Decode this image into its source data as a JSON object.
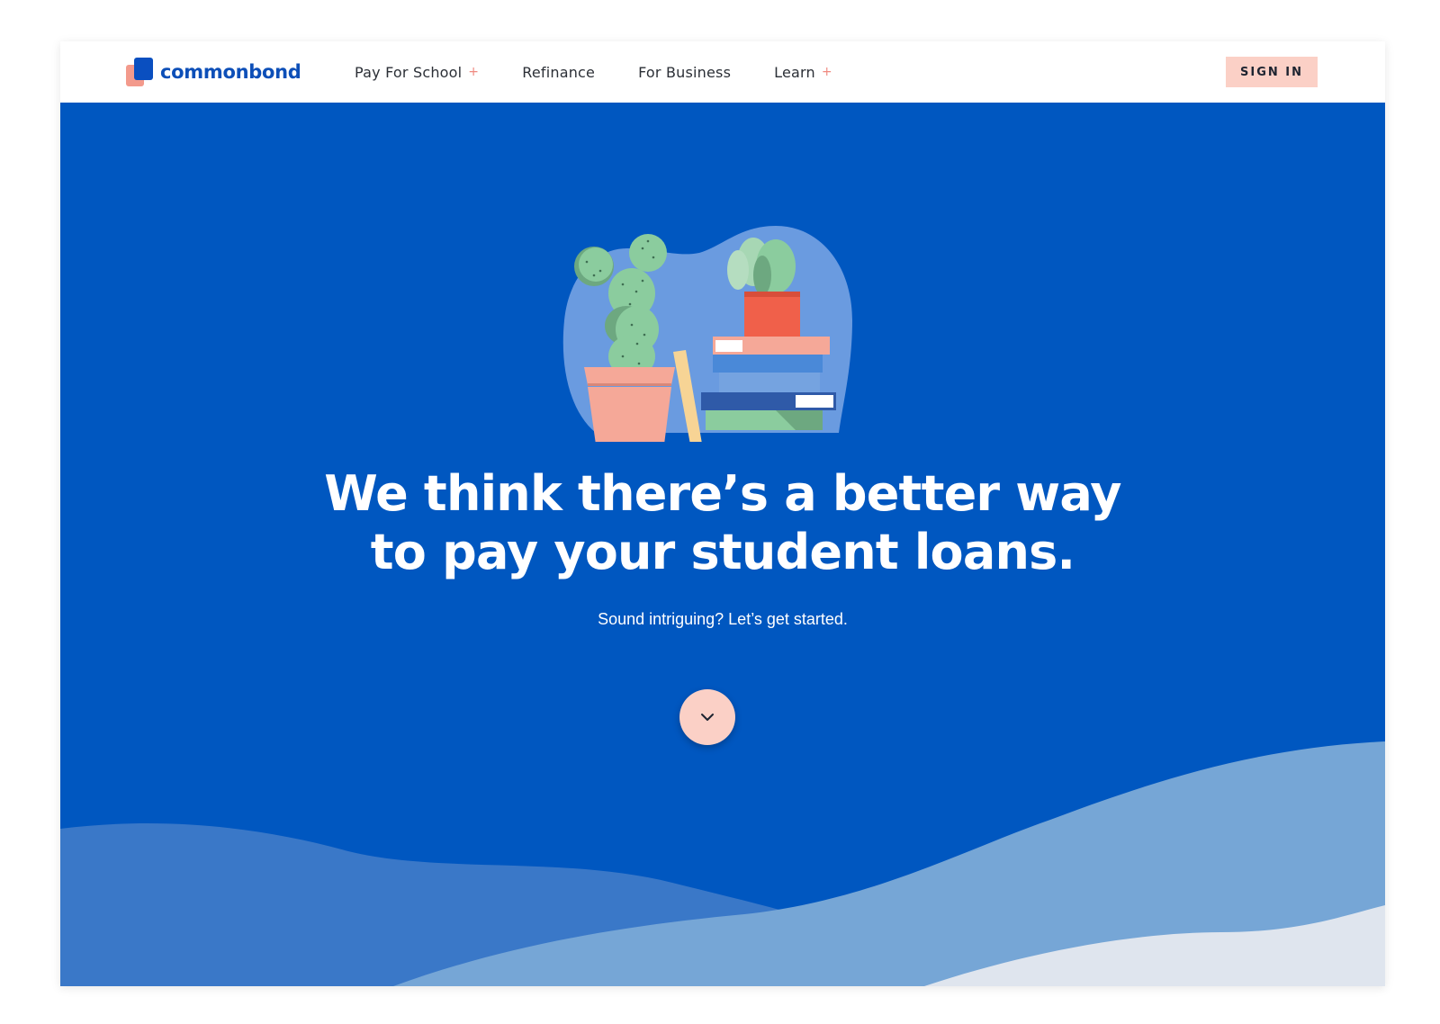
{
  "brand": {
    "name": "commonbond"
  },
  "nav": {
    "items": [
      {
        "label": "Pay For School",
        "has_submenu": true
      },
      {
        "label": "Refinance",
        "has_submenu": false
      },
      {
        "label": "For Business",
        "has_submenu": false
      },
      {
        "label": "Learn",
        "has_submenu": true
      }
    ],
    "submenu_indicator": "+",
    "sign_in_label": "SIGN IN"
  },
  "hero": {
    "headline_line1": "We think there’s a better way",
    "headline_line2": "to pay your student loans.",
    "subheadline": "Sound intriguing? Let’s get started.",
    "scroll_icon": "chevron-down-icon"
  },
  "colors": {
    "hero_background": "#0057c0",
    "accent_pink": "#fbd0c6",
    "brand_blue": "#0d4fb8",
    "plus_accent": "#f08a80"
  }
}
